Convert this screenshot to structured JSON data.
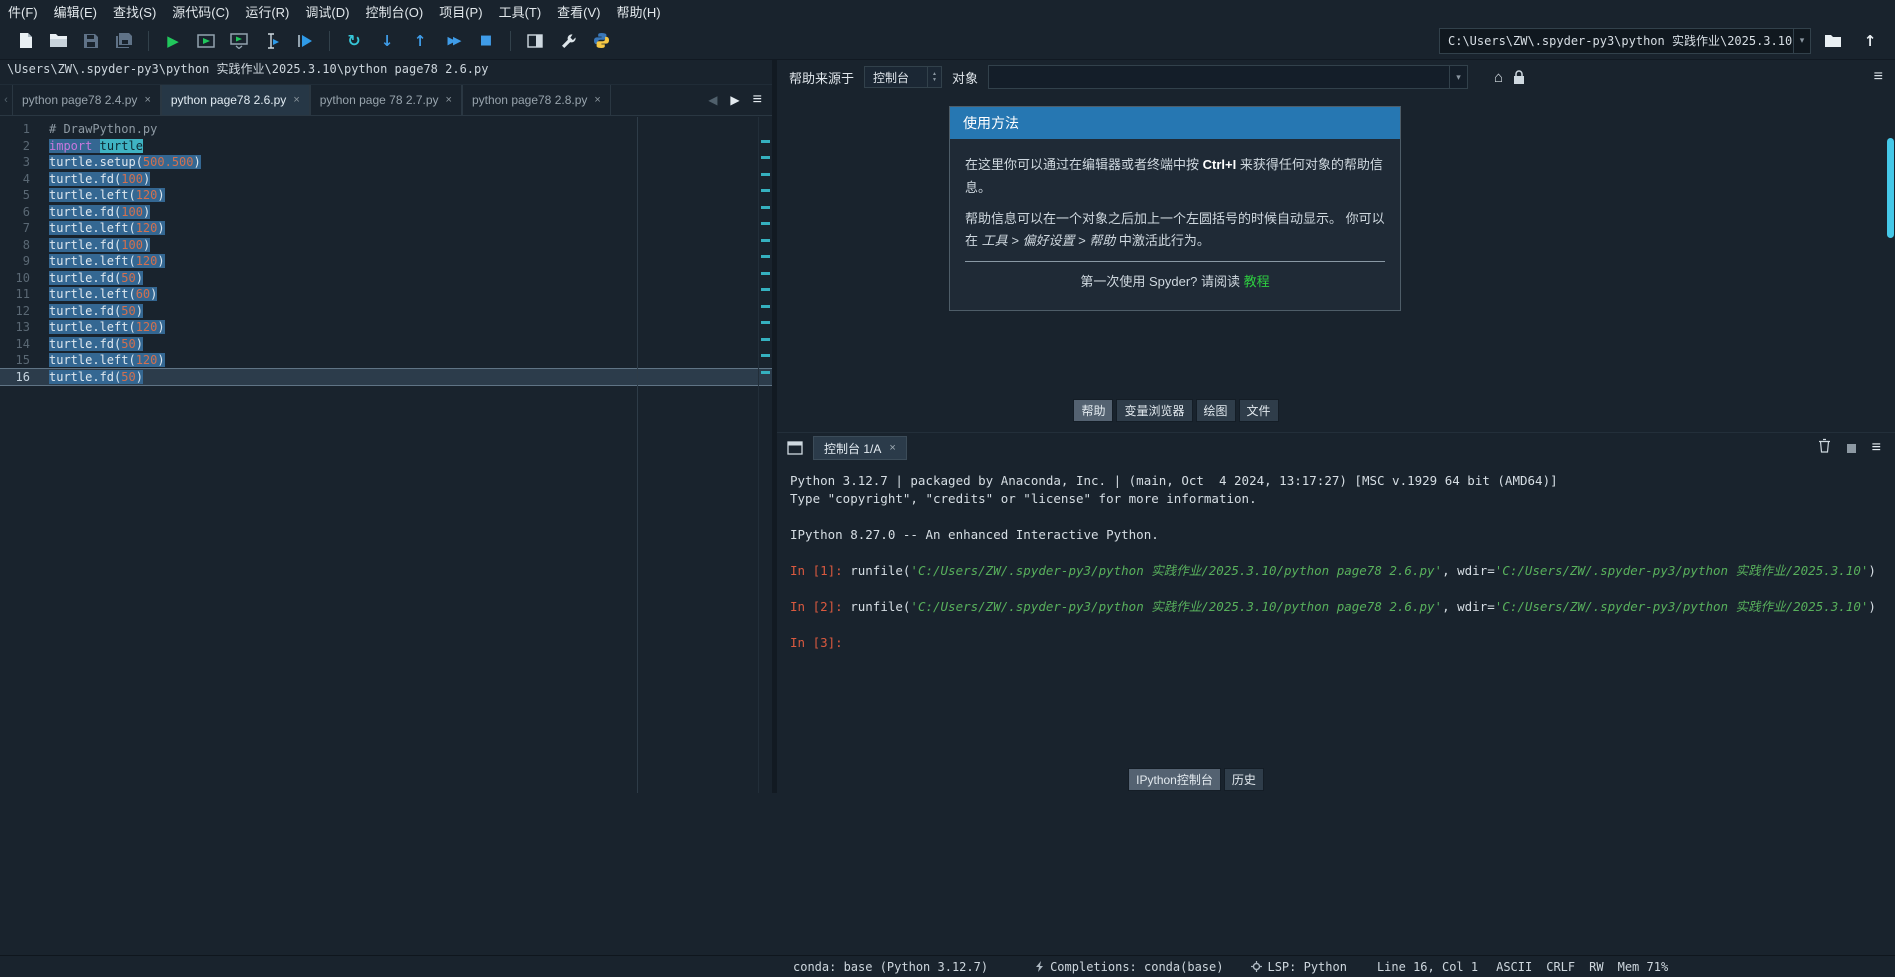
{
  "glyphs": {
    "play": "▶",
    "rerun": "↻",
    "down": "↓",
    "up": "↑",
    "ff": "▶▶",
    "stop": "■",
    "home": "⌂",
    "menu": "≡",
    "close": "×",
    "left": "◀",
    "right": "▶",
    "dropdown": "▾",
    "spin_up": "▲",
    "spin_down": "▼",
    "chevron": "‹"
  },
  "menu": {
    "items": [
      "件(F)",
      "编辑(E)",
      "查找(S)",
      "源代码(C)",
      "运行(R)",
      "调试(D)",
      "控制台(O)",
      "项目(P)",
      "工具(T)",
      "查看(V)",
      "帮助(H)"
    ]
  },
  "toolbar": {
    "working_dir": "C:\\Users\\ZW\\.spyder-py3\\python 实践作业\\2025.3.10",
    "icons": [
      "new-file",
      "open-file",
      "save-file",
      "save-all",
      "run-file",
      "run-cell",
      "run-cell-and-advance",
      "run-selection",
      "run-to-line",
      "re-run-last-script",
      "debug-next-line",
      "debug-step-return",
      "debug-continue",
      "stop",
      "maximize-pane",
      "tools",
      "python-path-manager",
      "browse-working-directory",
      "go-to-parent-directory"
    ]
  },
  "editor": {
    "breadcrumb": "\\Users\\ZW\\.spyder-py3\\python 实践作业\\2025.3.10\\python page78 2.6.py",
    "tabs": [
      {
        "label": "python  page78  2.4.py",
        "active": false
      },
      {
        "label": "python page78 2.6.py",
        "active": true
      },
      {
        "label": "python page 78 2.7.py",
        "active": false
      },
      {
        "label": "python page78 2.8.py",
        "active": false
      }
    ],
    "lines": [
      {
        "n": 1,
        "sel": false,
        "flag": false,
        "tokens": [
          [
            "com",
            "# DrawPython.py"
          ]
        ]
      },
      {
        "n": 2,
        "sel": true,
        "flag": true,
        "tokens": [
          [
            "kw",
            "import"
          ],
          [
            "t",
            " "
          ],
          [
            "occ",
            "turtle"
          ]
        ]
      },
      {
        "n": 3,
        "sel": true,
        "flag": true,
        "tokens": [
          [
            "t",
            "turtle.setup("
          ],
          [
            "num",
            "500.500"
          ],
          [
            "t",
            ")"
          ]
        ]
      },
      {
        "n": 4,
        "sel": true,
        "flag": true,
        "tokens": [
          [
            "t",
            "turtle.fd("
          ],
          [
            "num",
            "100"
          ],
          [
            "t",
            ")"
          ]
        ]
      },
      {
        "n": 5,
        "sel": true,
        "flag": true,
        "tokens": [
          [
            "t",
            "turtle.left("
          ],
          [
            "num",
            "120"
          ],
          [
            "t",
            ")"
          ]
        ]
      },
      {
        "n": 6,
        "sel": true,
        "flag": true,
        "tokens": [
          [
            "t",
            "turtle.fd("
          ],
          [
            "num",
            "100"
          ],
          [
            "t",
            ")"
          ]
        ]
      },
      {
        "n": 7,
        "sel": true,
        "flag": true,
        "tokens": [
          [
            "t",
            "turtle.left("
          ],
          [
            "num",
            "120"
          ],
          [
            "t",
            ")"
          ]
        ]
      },
      {
        "n": 8,
        "sel": true,
        "flag": true,
        "tokens": [
          [
            "t",
            "turtle.fd("
          ],
          [
            "num",
            "100"
          ],
          [
            "t",
            ")"
          ]
        ]
      },
      {
        "n": 9,
        "sel": true,
        "flag": true,
        "tokens": [
          [
            "t",
            "turtle.left("
          ],
          [
            "num",
            "120"
          ],
          [
            "t",
            ")"
          ]
        ]
      },
      {
        "n": 10,
        "sel": true,
        "flag": true,
        "tokens": [
          [
            "t",
            "turtle.fd("
          ],
          [
            "num",
            "50"
          ],
          [
            "t",
            ")"
          ]
        ]
      },
      {
        "n": 11,
        "sel": true,
        "flag": true,
        "tokens": [
          [
            "t",
            "turtle.left("
          ],
          [
            "num",
            "60"
          ],
          [
            "t",
            ")"
          ]
        ]
      },
      {
        "n": 12,
        "sel": true,
        "flag": true,
        "tokens": [
          [
            "t",
            "turtle.fd("
          ],
          [
            "num",
            "50"
          ],
          [
            "t",
            ")"
          ]
        ]
      },
      {
        "n": 13,
        "sel": true,
        "flag": true,
        "tokens": [
          [
            "t",
            "turtle.left("
          ],
          [
            "num",
            "120"
          ],
          [
            "t",
            ")"
          ]
        ]
      },
      {
        "n": 14,
        "sel": true,
        "flag": true,
        "tokens": [
          [
            "t",
            "turtle.fd("
          ],
          [
            "num",
            "50"
          ],
          [
            "t",
            ")"
          ]
        ]
      },
      {
        "n": 15,
        "sel": true,
        "flag": true,
        "tokens": [
          [
            "t",
            "turtle.left("
          ],
          [
            "num",
            "120"
          ],
          [
            "t",
            ")"
          ]
        ]
      },
      {
        "n": 16,
        "sel": true,
        "flag": true,
        "current": true,
        "tokens": [
          [
            "t",
            "turtle.fd("
          ],
          [
            "num",
            "50"
          ],
          [
            "t",
            ")"
          ]
        ]
      }
    ]
  },
  "help": {
    "source_label": "帮助来源于",
    "source_value": "控制台",
    "object_label": "对象",
    "object_value": "",
    "usage": {
      "title": "使用方法",
      "p1_pre": "在这里你可以通过在编辑器或者终端中按 ",
      "p1_key": "Ctrl+I",
      "p1_post": " 来获得任何对象的帮助信息。",
      "p2_pre": "帮助信息可以在一个对象之后加上一个左圆括号的时候自动显示。 你可以在 ",
      "p2_em": "工具 > 偏好设置 > 帮助",
      "p2_post": " 中激活此行为。",
      "footer_pre": "第一次使用 Spyder? 请阅读 ",
      "footer_link": "教程"
    },
    "bottom_tabs": [
      {
        "label": "帮助",
        "active": true
      },
      {
        "label": "变量浏览器",
        "active": false
      },
      {
        "label": "绘图",
        "active": false
      },
      {
        "label": "文件",
        "active": false
      }
    ]
  },
  "console": {
    "tab_label": "控制台 1/A",
    "banner": [
      "Python 3.12.7 | packaged by Anaconda, Inc. | (main, Oct  4 2024, 13:17:27) [MSC v.1929 64 bit (AMD64)]",
      "Type \"copyright\", \"credits\" or \"license\" for more information.",
      "",
      "IPython 8.27.0 -- An enhanced Interactive Python."
    ],
    "entries": [
      {
        "tokens": [
          [
            "prompt",
            "In [1]:"
          ],
          [
            "t",
            " runfile("
          ],
          [
            "str",
            "'C:/Users/ZW/.spyder-py3/python 实践作业/2025.3.10/python page78 2.6.py'"
          ],
          [
            "t",
            ", wdir="
          ],
          [
            "str",
            "'C:/Users/ZW/.spyder-py3/python 实践作业/2025.3.10'"
          ],
          [
            "t",
            ")"
          ]
        ]
      },
      {
        "tokens": [
          [
            "prompt",
            "In [2]:"
          ],
          [
            "t",
            " runfile("
          ],
          [
            "str",
            "'C:/Users/ZW/.spyder-py3/python 实践作业/2025.3.10/python page78 2.6.py'"
          ],
          [
            "t",
            ", wdir="
          ],
          [
            "str",
            "'C:/Users/ZW/.spyder-py3/python 实践作业/2025.3.10'"
          ],
          [
            "t",
            ")"
          ]
        ]
      },
      {
        "tokens": [
          [
            "prompt",
            "In [3]:"
          ]
        ]
      }
    ],
    "bottom_tabs": [
      {
        "label": "IPython控制台",
        "active": true
      },
      {
        "label": "历史",
        "active": false
      }
    ]
  },
  "status": {
    "conda": "conda: base (Python 3.12.7)",
    "completions": "Completions: conda(base)",
    "lsp": "LSP: Python",
    "cursor": "Line 16, Col 1",
    "encoding": "ASCII",
    "eol": "CRLF",
    "rw": "RW",
    "mem": "Mem 71%"
  }
}
